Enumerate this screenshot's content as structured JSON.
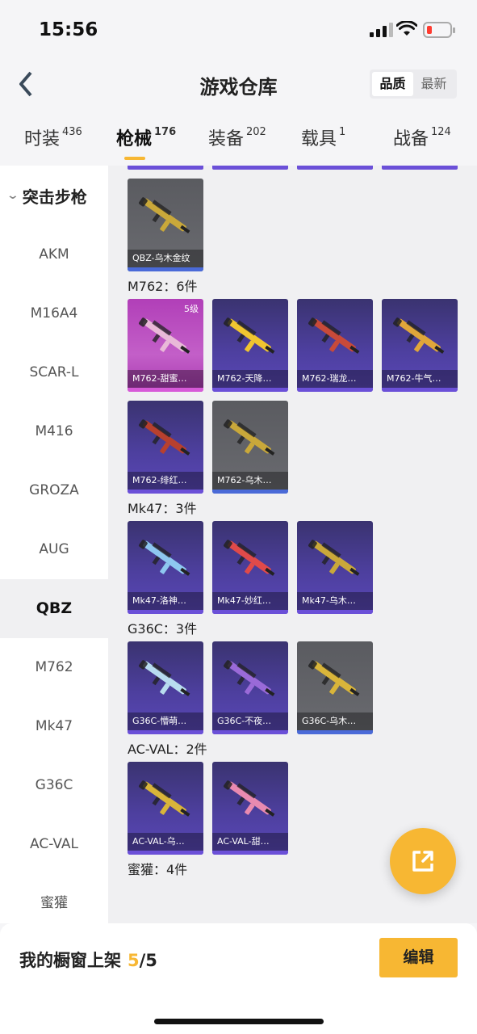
{
  "status_bar": {
    "time": "15:56"
  },
  "header": {
    "title": "游戏仓库",
    "sort": [
      "品质",
      "最新"
    ],
    "sort_active": 0
  },
  "tabs": [
    {
      "label": "时装",
      "count": "436"
    },
    {
      "label": "枪械",
      "count": "176",
      "active": true
    },
    {
      "label": "装备",
      "count": "202"
    },
    {
      "label": "载具",
      "count": "1"
    },
    {
      "label": "战备",
      "count": "124"
    }
  ],
  "sidebar": {
    "category": "突击步枪",
    "items": [
      "AKM",
      "M16A4",
      "SCAR-L",
      "M416",
      "GROZA",
      "AUG",
      "QBZ",
      "M762",
      "Mk47",
      "G36C",
      "AC-VAL",
      "蜜獾"
    ],
    "selected": "QBZ"
  },
  "sections": [
    {
      "title": "",
      "items": [
        {
          "name": "QBZ-乌木金纹",
          "tier": "gray",
          "gun": "#c9a83a"
        }
      ]
    },
    {
      "title": "M762：6件",
      "items": [
        {
          "name": "M762-甜蜜…",
          "tier": "pink",
          "level": "5级",
          "gun": "#e9b9d8"
        },
        {
          "name": "M762-天降…",
          "tier": "purple",
          "gun": "#f0c530"
        },
        {
          "name": "M762-瑞龙…",
          "tier": "purple",
          "gun": "#c84a3a"
        },
        {
          "name": "M762-牛气…",
          "tier": "purple",
          "gun": "#e0a63a"
        },
        {
          "name": "M762-绯红…",
          "tier": "purple",
          "gun": "#b8402e"
        },
        {
          "name": "M762-乌木…",
          "tier": "gray",
          "gun": "#c9a83a"
        }
      ]
    },
    {
      "title": "Mk47：3件",
      "items": [
        {
          "name": "Mk47-洛神…",
          "tier": "purple",
          "gun": "#8ec7f0"
        },
        {
          "name": "Mk47-妙红…",
          "tier": "purple",
          "gun": "#e04a4a"
        },
        {
          "name": "Mk47-乌木…",
          "tier": "purple",
          "gun": "#c9a83a"
        }
      ]
    },
    {
      "title": "G36C：3件",
      "items": [
        {
          "name": "G36C-懵萌…",
          "tier": "purple",
          "gun": "#b8dcef"
        },
        {
          "name": "G36C-不夜…",
          "tier": "purple",
          "gun": "#9a6ad8"
        },
        {
          "name": "G36C-乌木…",
          "tier": "gray",
          "gun": "#d9b53a"
        }
      ]
    },
    {
      "title": "AC-VAL：2件",
      "items": [
        {
          "name": "AC-VAL-乌…",
          "tier": "purple",
          "gun": "#d9b53a"
        },
        {
          "name": "AC-VAL-甜…",
          "tier": "purple",
          "gun": "#e98ab0"
        }
      ]
    },
    {
      "title": "蜜獾：4件",
      "items": []
    }
  ],
  "bottom": {
    "shelf_label": "我的橱窗上架",
    "shelf_current": "5",
    "shelf_total": "/5",
    "edit_label": "编辑"
  }
}
